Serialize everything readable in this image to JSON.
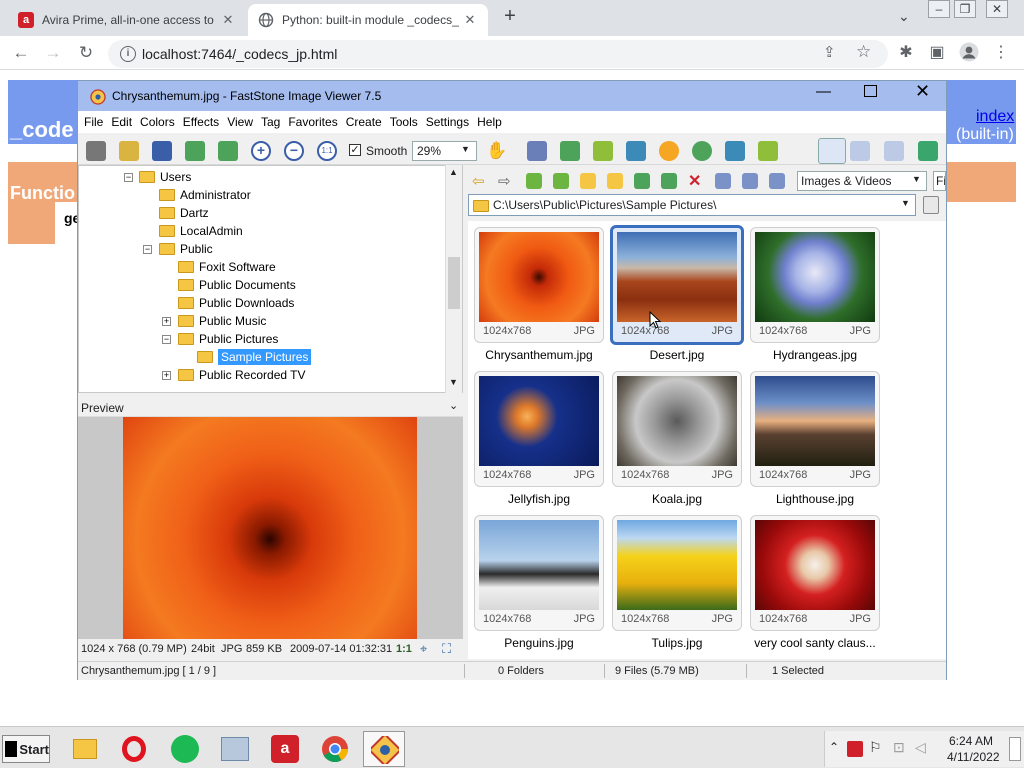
{
  "browser": {
    "tabs": [
      {
        "title": "Avira Prime, all-in-one access to",
        "active": false
      },
      {
        "title": "Python: built-in module _codecs_",
        "active": true
      }
    ],
    "url": "localhost:7464/_codecs_jp.html"
  },
  "webpage": {
    "heading": "_code",
    "index_link": "index",
    "builtin": "(built-in)",
    "functions": "Functio",
    "ge": "ge"
  },
  "app": {
    "title": "Chrysanthemum.jpg - FastStone Image Viewer 7.5",
    "menu": [
      "File",
      "Edit",
      "Colors",
      "Effects",
      "View",
      "Tag",
      "Favorites",
      "Create",
      "Tools",
      "Settings",
      "Help"
    ],
    "smooth_label": "Smooth",
    "zoom_value": "29%",
    "filter_value": "Images & Videos",
    "filter_extra": "Fi",
    "path": "C:\\Users\\Public\\Pictures\\Sample Pictures\\",
    "tree": [
      {
        "label": "Users",
        "level": 0,
        "expander": "-"
      },
      {
        "label": "Administrator",
        "level": 1,
        "expander": ""
      },
      {
        "label": "Dartz",
        "level": 1,
        "expander": ""
      },
      {
        "label": "LocalAdmin",
        "level": 1,
        "expander": ""
      },
      {
        "label": "Public",
        "level": 1,
        "expander": "-"
      },
      {
        "label": "Foxit Software",
        "level": 2,
        "expander": ""
      },
      {
        "label": "Public Documents",
        "level": 2,
        "expander": ""
      },
      {
        "label": "Public Downloads",
        "level": 2,
        "expander": ""
      },
      {
        "label": "Public Music",
        "level": 2,
        "expander": "+"
      },
      {
        "label": "Public Pictures",
        "level": 2,
        "expander": "-"
      },
      {
        "label": "Sample Pictures",
        "level": 3,
        "expander": "",
        "selected": true
      },
      {
        "label": "Public Recorded TV",
        "level": 2,
        "expander": "+"
      }
    ],
    "preview_label": "Preview",
    "preview_info": {
      "dims": "1024 x 768 (0.79 MP)",
      "bits": "24bit",
      "format": "JPG",
      "size": "859 KB",
      "date": "2009-07-14 01:32:31",
      "ratio": "1:1"
    },
    "thumbnails": [
      {
        "name": "Chrysanthemum.jpg",
        "dims": "1024x768",
        "ext": "JPG",
        "selected": false
      },
      {
        "name": "Desert.jpg",
        "dims": "1024x768",
        "ext": "JPG",
        "selected": true
      },
      {
        "name": "Hydrangeas.jpg",
        "dims": "1024x768",
        "ext": "JPG",
        "selected": false
      },
      {
        "name": "Jellyfish.jpg",
        "dims": "1024x768",
        "ext": "JPG",
        "selected": false
      },
      {
        "name": "Koala.jpg",
        "dims": "1024x768",
        "ext": "JPG",
        "selected": false
      },
      {
        "name": "Lighthouse.jpg",
        "dims": "1024x768",
        "ext": "JPG",
        "selected": false
      },
      {
        "name": "Penguins.jpg",
        "dims": "1024x768",
        "ext": "JPG",
        "selected": false
      },
      {
        "name": "Tulips.jpg",
        "dims": "1024x768",
        "ext": "JPG",
        "selected": false
      },
      {
        "name": "very cool santy claus...",
        "dims": "1024x768",
        "ext": "JPG",
        "selected": false
      }
    ],
    "status": {
      "file": "Chrysanthemum.jpg [ 1 / 9 ]",
      "folders": "0 Folders",
      "files": "9 Files (5.79 MB)",
      "selected": "1 Selected"
    }
  },
  "taskbar": {
    "start": "Start",
    "time": "6:24 AM",
    "date": "4/11/2022"
  }
}
